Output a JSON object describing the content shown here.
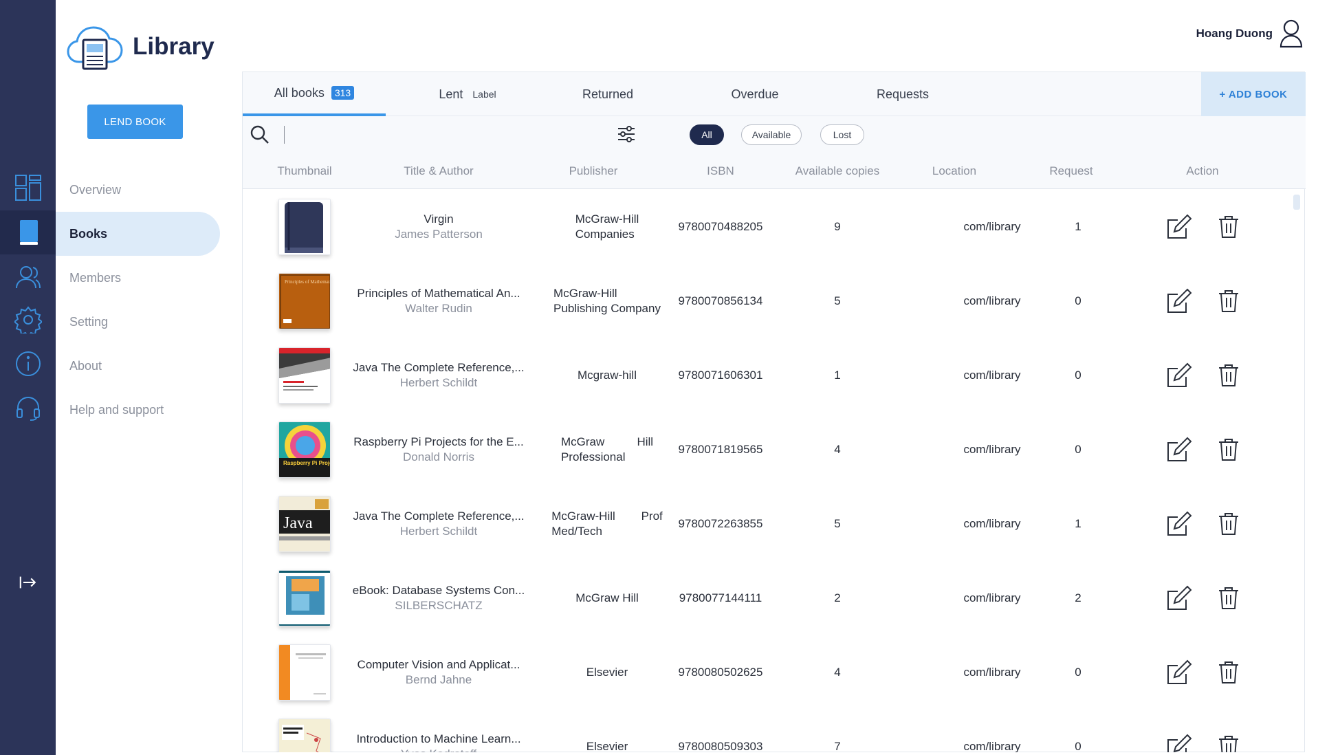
{
  "app": {
    "title": "Library"
  },
  "user": {
    "name": "Hoang Duong"
  },
  "sidebar": {
    "lend_label": "LEND BOOK",
    "items": [
      {
        "label": "Overview"
      },
      {
        "label": "Books"
      },
      {
        "label": "Members"
      },
      {
        "label": "Setting"
      },
      {
        "label": "About"
      },
      {
        "label": "Help and support"
      }
    ]
  },
  "tabs": [
    {
      "label": "All books",
      "badge": "313"
    },
    {
      "label": "Lent",
      "extra": "Label"
    },
    {
      "label": "Returned"
    },
    {
      "label": "Overdue"
    },
    {
      "label": "Requests"
    }
  ],
  "add_book_label": "+ ADD BOOK",
  "filters": [
    "All",
    "Available",
    "Lost"
  ],
  "columns": [
    "Thumbnail",
    "Title & Author",
    "Publisher",
    "ISBN",
    "Available copies",
    "Location",
    "Request",
    "Action"
  ],
  "rows": [
    {
      "title": "Virgin",
      "author": "James Patterson",
      "publisher_line1": "McGraw-Hill",
      "publisher_line2": "Companies",
      "isbn": "9780070488205",
      "copies": "9",
      "location": "com/library",
      "request": "1"
    },
    {
      "title": "Principles of Mathematical An...",
      "author": "Walter Rudin",
      "publisher_line1": "McGraw-Hill",
      "publisher_line2": "Publishing Company",
      "isbn": "9780070856134",
      "copies": "5",
      "location": "com/library",
      "request": "0"
    },
    {
      "title": "Java The Complete Reference,...",
      "author": "Herbert Schildt",
      "publisher_line1": "Mcgraw-hill",
      "publisher_line2": "",
      "isbn": "9780071606301",
      "copies": "1",
      "location": "com/library",
      "request": "0"
    },
    {
      "title": "Raspberry Pi Projects for the E...",
      "author": "Donald Norris",
      "publisher_line1": "McGraw          Hill",
      "publisher_line2": "Professional",
      "isbn": "9780071819565",
      "copies": "4",
      "location": "com/library",
      "request": "0"
    },
    {
      "title": "Java The Complete Reference,...",
      "author": "Herbert Schildt",
      "publisher_line1": "McGraw-Hill        Prof",
      "publisher_line2": "Med/Tech",
      "isbn": "9780072263855",
      "copies": "5",
      "location": "com/library",
      "request": "1"
    },
    {
      "title": "eBook: Database Systems Con...",
      "author": "SILBERSCHATZ",
      "publisher_line1": "McGraw Hill",
      "publisher_line2": "",
      "isbn": "9780077144111",
      "copies": "2",
      "location": "com/library",
      "request": "2"
    },
    {
      "title": "Computer Vision and Applicat...",
      "author": "Bernd Jahne",
      "publisher_line1": "Elsevier",
      "publisher_line2": "",
      "isbn": "9780080502625",
      "copies": "4",
      "location": "com/library",
      "request": "0"
    },
    {
      "title": "Introduction to Machine Learn...",
      "author": "Yves Kodratoff",
      "publisher_line1": "Elsevier",
      "publisher_line2": "",
      "isbn": "9780080509303",
      "copies": "7",
      "location": "com/library",
      "request": "0"
    }
  ],
  "book_cover_art": {
    "principles": "Principles of Mathematical Analysis",
    "raspberry": "Raspberry Pi Projects for the Evil Genius",
    "java": "Java"
  },
  "colors": {
    "rail": "#2c3459",
    "accent": "#3a96e8",
    "active_chip": "#1f2a4e"
  },
  "icons": [
    "dashboard-icon",
    "book-icon",
    "members-icon",
    "gear-icon",
    "info-icon",
    "headset-icon",
    "logout-icon",
    "search-icon",
    "filter-icon",
    "edit-icon",
    "trash-icon",
    "user-icon",
    "cloud-book-icon"
  ]
}
